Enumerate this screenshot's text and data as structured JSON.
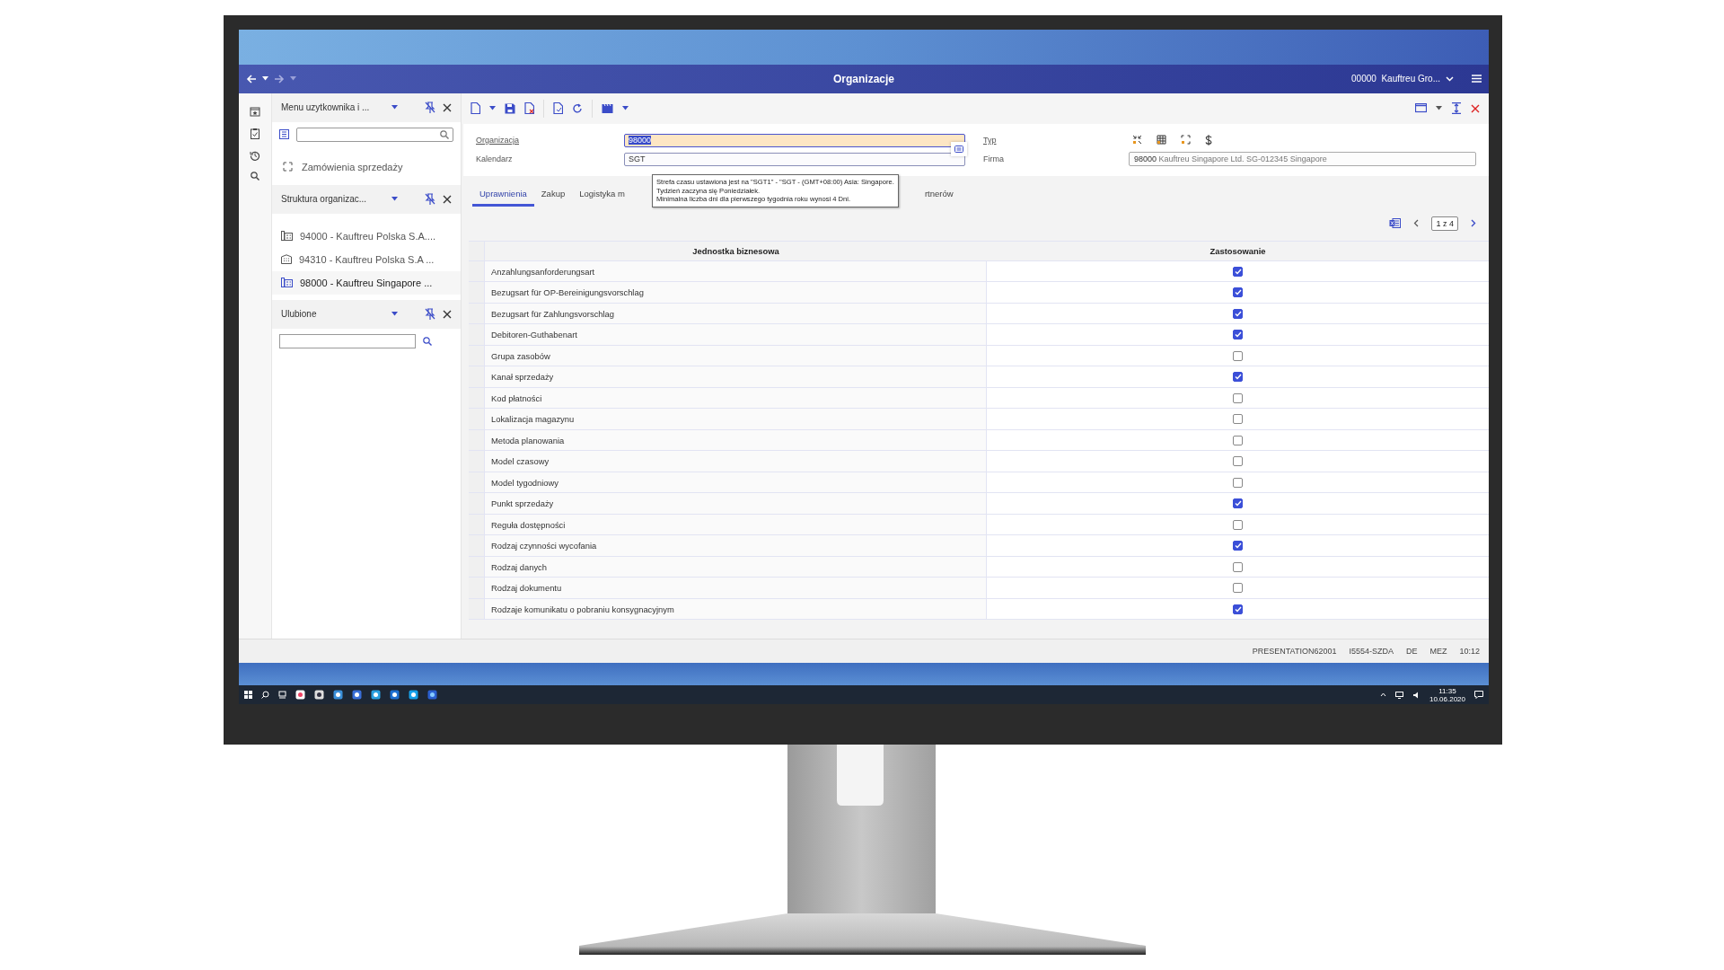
{
  "window": {
    "title": "Organizacje",
    "company": "00000  Kauftreu Gro..."
  },
  "menu_panel": {
    "title": "Menu uzytkownika i ...",
    "entries": [
      "Zamówienia sprzedaży"
    ]
  },
  "structure_panel": {
    "title": "Struktura organizac...",
    "items": [
      {
        "label": "94000 - Kauftreu Polska S.A....",
        "kind": "group",
        "selected": false
      },
      {
        "label": "94310 - Kauftreu Polska S.A ...",
        "kind": "building",
        "selected": false
      },
      {
        "label": "98000 - Kauftreu Singapore ...",
        "kind": "group",
        "selected": true
      }
    ]
  },
  "favorites_panel": {
    "title": "Ulubione"
  },
  "form": {
    "fields": [
      {
        "label": "Organizacja",
        "value": "98000",
        "focused": true
      },
      {
        "label": "Kalendarz",
        "value": "SGT",
        "focused": false
      }
    ],
    "type_label": "Typ",
    "company_label": "Firma",
    "company_number": "98000",
    "company_name": "Kauftreu Singapore Ltd. SG-012345 Singapore"
  },
  "tooltip": {
    "lines": [
      "Strefa czasu ustawiona jest na \"SGT1\" - \"SGT - (GMT+08:00) Asia: Singapore.",
      "Tydzień zaczyna się Poniedziałek.",
      "Minimalna liczba dni dla pierwszego tygodnia roku wynosi 4 Dni."
    ]
  },
  "tabs": [
    {
      "label": "Uprawnienia",
      "selected": true
    },
    {
      "label": "Zakup",
      "selected": false
    },
    {
      "label": "Logistyka m",
      "selected": false
    },
    {
      "label": "rtnerów",
      "selected": false
    }
  ],
  "pager": {
    "text": "1 z 4"
  },
  "table": {
    "columns": [
      "Jednostka biznesowa",
      "Zastosowanie"
    ],
    "rows": [
      {
        "name": "Anzahlungsanforderungsart",
        "checked": true
      },
      {
        "name": "Bezugsart für OP-Bereinigungsvorschlag",
        "checked": true
      },
      {
        "name": "Bezugsart für Zahlungsvorschlag",
        "checked": true
      },
      {
        "name": "Debitoren-Guthabenart",
        "checked": true
      },
      {
        "name": "Grupa zasobów",
        "checked": false
      },
      {
        "name": "Kanał sprzedaży",
        "checked": true
      },
      {
        "name": "Kod płatności",
        "checked": false
      },
      {
        "name": "Lokalizacja magazynu",
        "checked": false
      },
      {
        "name": "Metoda planowania",
        "checked": false
      },
      {
        "name": "Model czasowy",
        "checked": false
      },
      {
        "name": "Model tygodniowy",
        "checked": false
      },
      {
        "name": "Punkt sprzedaży",
        "checked": true
      },
      {
        "name": "Reguła dostępności",
        "checked": false
      },
      {
        "name": "Rodzaj czynności wycofania",
        "checked": true
      },
      {
        "name": "Rodzaj danych",
        "checked": false
      },
      {
        "name": "Rodzaj dokumentu",
        "checked": false
      },
      {
        "name": "Rodzaje komunikatu o pobraniu konsygnacyjnym",
        "checked": true
      }
    ]
  },
  "status_bar": [
    "PRESENTATION62001",
    "I5554-SZDA",
    "DE",
    "MEZ",
    "10:12"
  ],
  "taskbar": {
    "time": "11:35",
    "date": "10.06.2020"
  }
}
